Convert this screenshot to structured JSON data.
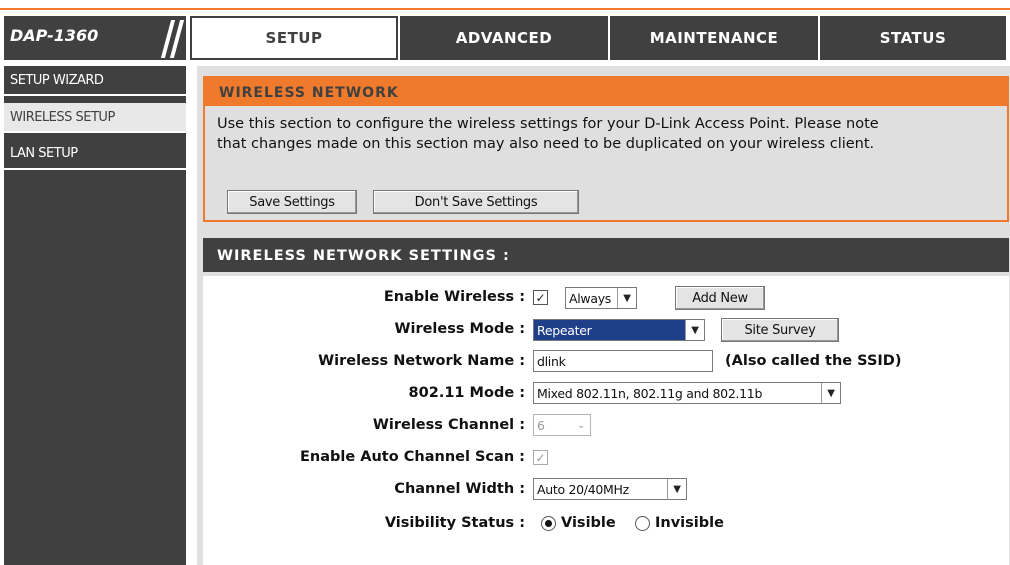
{
  "header": {
    "model": "DAP-1360",
    "tabs": [
      "SETUP",
      "ADVANCED",
      "MAINTENANCE",
      "STATUS"
    ],
    "active_tab": "SETUP"
  },
  "sidebar": {
    "items": [
      {
        "label": "SETUP WIZARD"
      },
      {
        "label": "WIRELESS SETUP"
      },
      {
        "label": "LAN SETUP"
      }
    ],
    "active_item": "WIRELESS SETUP"
  },
  "wireless_network": {
    "title": "WIRELESS NETWORK",
    "description_line1": "Use this section to configure the wireless settings for your D-Link Access Point. Please note",
    "description_line2": "that changes made on this section may also need to be duplicated on your wireless client.",
    "save_label": "Save Settings",
    "dont_save_label": "Don't Save Settings"
  },
  "settings": {
    "title": "WIRELESS NETWORK SETTINGS :",
    "enable_wireless_label": "Enable Wireless :",
    "enable_wireless_checked": true,
    "schedule_value": "Always",
    "add_new_label": "Add New",
    "wireless_mode_label": "Wireless Mode :",
    "wireless_mode_value": "Repeater",
    "site_survey_label": "Site Survey",
    "network_name_label": "Wireless Network Name :",
    "network_name_value": "dlink",
    "ssid_note": "(Also called the SSID)",
    "mode_80211_label": "802.11 Mode :",
    "mode_80211_value": "Mixed 802.11n, 802.11g and 802.11b",
    "channel_label": "Wireless Channel :",
    "channel_value": "6",
    "auto_scan_label": "Enable Auto Channel Scan :",
    "auto_scan_checked": true,
    "channel_width_label": "Channel Width :",
    "channel_width_value": "Auto 20/40MHz",
    "visibility_label": "Visibility Status :",
    "visible_label": "Visible",
    "invisible_label": "Invisible",
    "visibility_selected": "Visible"
  },
  "colors": {
    "accent": "#f07a2b",
    "dark": "#404040",
    "panel": "#dfdfdf",
    "selection": "#1f3f8a"
  }
}
